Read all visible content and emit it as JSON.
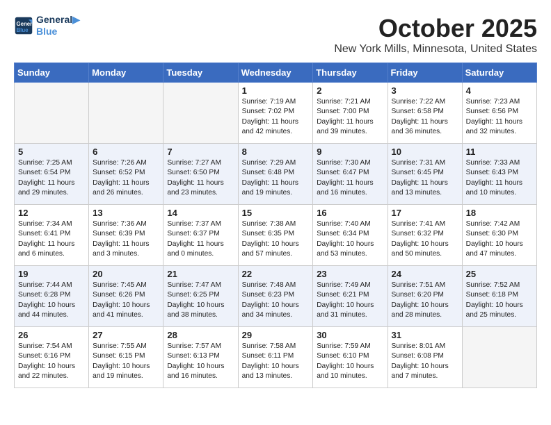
{
  "logo": {
    "line1": "General",
    "line2": "Blue"
  },
  "title": "October 2025",
  "location": "New York Mills, Minnesota, United States",
  "days_of_week": [
    "Sunday",
    "Monday",
    "Tuesday",
    "Wednesday",
    "Thursday",
    "Friday",
    "Saturday"
  ],
  "weeks": [
    [
      {
        "day": "",
        "content": ""
      },
      {
        "day": "",
        "content": ""
      },
      {
        "day": "",
        "content": ""
      },
      {
        "day": "1",
        "content": "Sunrise: 7:19 AM\nSunset: 7:02 PM\nDaylight: 11 hours\nand 42 minutes."
      },
      {
        "day": "2",
        "content": "Sunrise: 7:21 AM\nSunset: 7:00 PM\nDaylight: 11 hours\nand 39 minutes."
      },
      {
        "day": "3",
        "content": "Sunrise: 7:22 AM\nSunset: 6:58 PM\nDaylight: 11 hours\nand 36 minutes."
      },
      {
        "day": "4",
        "content": "Sunrise: 7:23 AM\nSunset: 6:56 PM\nDaylight: 11 hours\nand 32 minutes."
      }
    ],
    [
      {
        "day": "5",
        "content": "Sunrise: 7:25 AM\nSunset: 6:54 PM\nDaylight: 11 hours\nand 29 minutes."
      },
      {
        "day": "6",
        "content": "Sunrise: 7:26 AM\nSunset: 6:52 PM\nDaylight: 11 hours\nand 26 minutes."
      },
      {
        "day": "7",
        "content": "Sunrise: 7:27 AM\nSunset: 6:50 PM\nDaylight: 11 hours\nand 23 minutes."
      },
      {
        "day": "8",
        "content": "Sunrise: 7:29 AM\nSunset: 6:48 PM\nDaylight: 11 hours\nand 19 minutes."
      },
      {
        "day": "9",
        "content": "Sunrise: 7:30 AM\nSunset: 6:47 PM\nDaylight: 11 hours\nand 16 minutes."
      },
      {
        "day": "10",
        "content": "Sunrise: 7:31 AM\nSunset: 6:45 PM\nDaylight: 11 hours\nand 13 minutes."
      },
      {
        "day": "11",
        "content": "Sunrise: 7:33 AM\nSunset: 6:43 PM\nDaylight: 11 hours\nand 10 minutes."
      }
    ],
    [
      {
        "day": "12",
        "content": "Sunrise: 7:34 AM\nSunset: 6:41 PM\nDaylight: 11 hours\nand 6 minutes."
      },
      {
        "day": "13",
        "content": "Sunrise: 7:36 AM\nSunset: 6:39 PM\nDaylight: 11 hours\nand 3 minutes."
      },
      {
        "day": "14",
        "content": "Sunrise: 7:37 AM\nSunset: 6:37 PM\nDaylight: 11 hours\nand 0 minutes."
      },
      {
        "day": "15",
        "content": "Sunrise: 7:38 AM\nSunset: 6:35 PM\nDaylight: 10 hours\nand 57 minutes."
      },
      {
        "day": "16",
        "content": "Sunrise: 7:40 AM\nSunset: 6:34 PM\nDaylight: 10 hours\nand 53 minutes."
      },
      {
        "day": "17",
        "content": "Sunrise: 7:41 AM\nSunset: 6:32 PM\nDaylight: 10 hours\nand 50 minutes."
      },
      {
        "day": "18",
        "content": "Sunrise: 7:42 AM\nSunset: 6:30 PM\nDaylight: 10 hours\nand 47 minutes."
      }
    ],
    [
      {
        "day": "19",
        "content": "Sunrise: 7:44 AM\nSunset: 6:28 PM\nDaylight: 10 hours\nand 44 minutes."
      },
      {
        "day": "20",
        "content": "Sunrise: 7:45 AM\nSunset: 6:26 PM\nDaylight: 10 hours\nand 41 minutes."
      },
      {
        "day": "21",
        "content": "Sunrise: 7:47 AM\nSunset: 6:25 PM\nDaylight: 10 hours\nand 38 minutes."
      },
      {
        "day": "22",
        "content": "Sunrise: 7:48 AM\nSunset: 6:23 PM\nDaylight: 10 hours\nand 34 minutes."
      },
      {
        "day": "23",
        "content": "Sunrise: 7:49 AM\nSunset: 6:21 PM\nDaylight: 10 hours\nand 31 minutes."
      },
      {
        "day": "24",
        "content": "Sunrise: 7:51 AM\nSunset: 6:20 PM\nDaylight: 10 hours\nand 28 minutes."
      },
      {
        "day": "25",
        "content": "Sunrise: 7:52 AM\nSunset: 6:18 PM\nDaylight: 10 hours\nand 25 minutes."
      }
    ],
    [
      {
        "day": "26",
        "content": "Sunrise: 7:54 AM\nSunset: 6:16 PM\nDaylight: 10 hours\nand 22 minutes."
      },
      {
        "day": "27",
        "content": "Sunrise: 7:55 AM\nSunset: 6:15 PM\nDaylight: 10 hours\nand 19 minutes."
      },
      {
        "day": "28",
        "content": "Sunrise: 7:57 AM\nSunset: 6:13 PM\nDaylight: 10 hours\nand 16 minutes."
      },
      {
        "day": "29",
        "content": "Sunrise: 7:58 AM\nSunset: 6:11 PM\nDaylight: 10 hours\nand 13 minutes."
      },
      {
        "day": "30",
        "content": "Sunrise: 7:59 AM\nSunset: 6:10 PM\nDaylight: 10 hours\nand 10 minutes."
      },
      {
        "day": "31",
        "content": "Sunrise: 8:01 AM\nSunset: 6:08 PM\nDaylight: 10 hours\nand 7 minutes."
      },
      {
        "day": "",
        "content": ""
      }
    ]
  ]
}
